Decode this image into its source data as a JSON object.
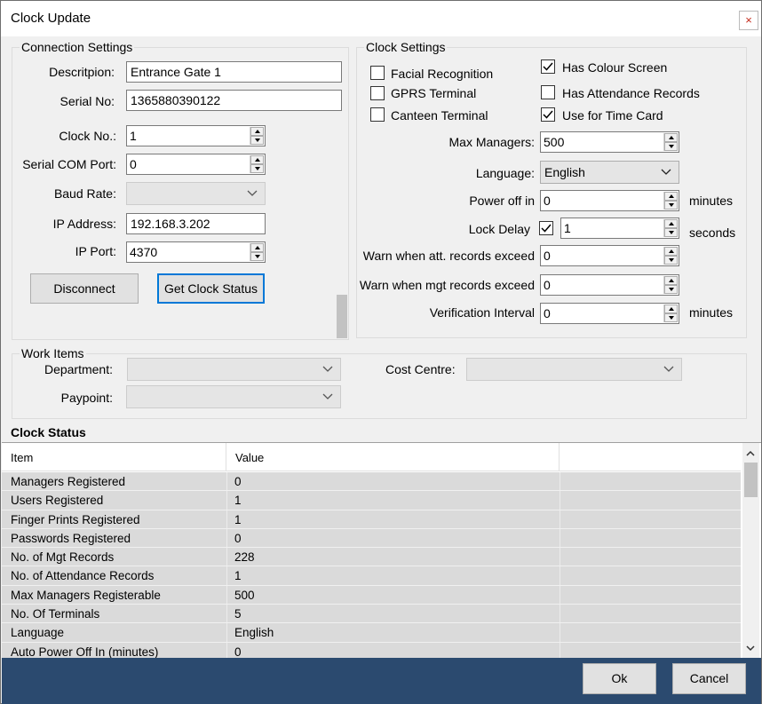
{
  "window": {
    "title": "Clock Update",
    "close_glyph": "×"
  },
  "connection": {
    "title": "Connection Settings",
    "description_label": "Descritpion:",
    "description_value": "Entrance Gate 1",
    "serial_label": "Serial No:",
    "serial_value": "1365880390122",
    "clock_no_label": "Clock No.:",
    "clock_no_value": "1",
    "serial_com_label": "Serial COM Port:",
    "serial_com_value": "0",
    "baud_label": "Baud Rate:",
    "baud_value": "",
    "ip_label": "IP Address:",
    "ip_value": "192.168.3.202",
    "port_label": "IP Port:",
    "port_value": "4370",
    "disconnect_label": "Disconnect",
    "status_label": "Get Clock Status"
  },
  "clock_settings": {
    "title": "Clock Settings",
    "facial_label": "Facial Recognition",
    "facial_checked": false,
    "gprs_label": "GPRS Terminal",
    "gprs_checked": false,
    "canteen_label": "Canteen Terminal",
    "canteen_checked": false,
    "colour_label": "Has Colour Screen",
    "colour_checked": true,
    "attendance_label": "Has Attendance Records",
    "attendance_checked": false,
    "timecard_label": "Use for Time Card",
    "timecard_checked": true,
    "max_managers_label": "Max Managers:",
    "max_managers_value": "500",
    "language_label": "Language:",
    "language_value": "English",
    "power_off_label": "Power off in",
    "power_off_value": "0",
    "power_off_unit": "minutes",
    "lock_delay_label": "Lock Delay",
    "lock_delay_checked": true,
    "lock_delay_value": "1",
    "lock_delay_unit": "seconds",
    "warn_att_label": "Warn when att. records exceed",
    "warn_att_value": "0",
    "warn_mgt_label": "Warn when mgt records exceed",
    "warn_mgt_value": "0",
    "verification_label": "Verification Interval",
    "verification_value": "0",
    "verification_unit": "minutes"
  },
  "work_items": {
    "title": "Work Items",
    "department_label": "Department:",
    "paypoint_label": "Paypoint:",
    "cost_centre_label": "Cost Centre:"
  },
  "clock_status": {
    "title": "Clock Status",
    "columns": [
      "Item",
      "Value",
      ""
    ],
    "rows": [
      [
        "Managers Registered",
        "0"
      ],
      [
        "Users Registered",
        "1"
      ],
      [
        "Finger Prints Registered",
        "1"
      ],
      [
        "Passwords Registered",
        "0"
      ],
      [
        "No. of Mgt Records",
        "228"
      ],
      [
        "No. of Attendance Records",
        "1"
      ],
      [
        "Max Managers Registerable",
        "500"
      ],
      [
        "No. Of Terminals",
        "5"
      ],
      [
        "Language",
        "English"
      ],
      [
        "Auto Power Off In (minutes)",
        "0"
      ]
    ]
  },
  "footer": {
    "ok_label": "Ok",
    "cancel_label": "Cancel"
  },
  "colors": {
    "accent": "#0078d7",
    "footer_bg": "#2b4a6f",
    "row_bg": "#dadada"
  }
}
